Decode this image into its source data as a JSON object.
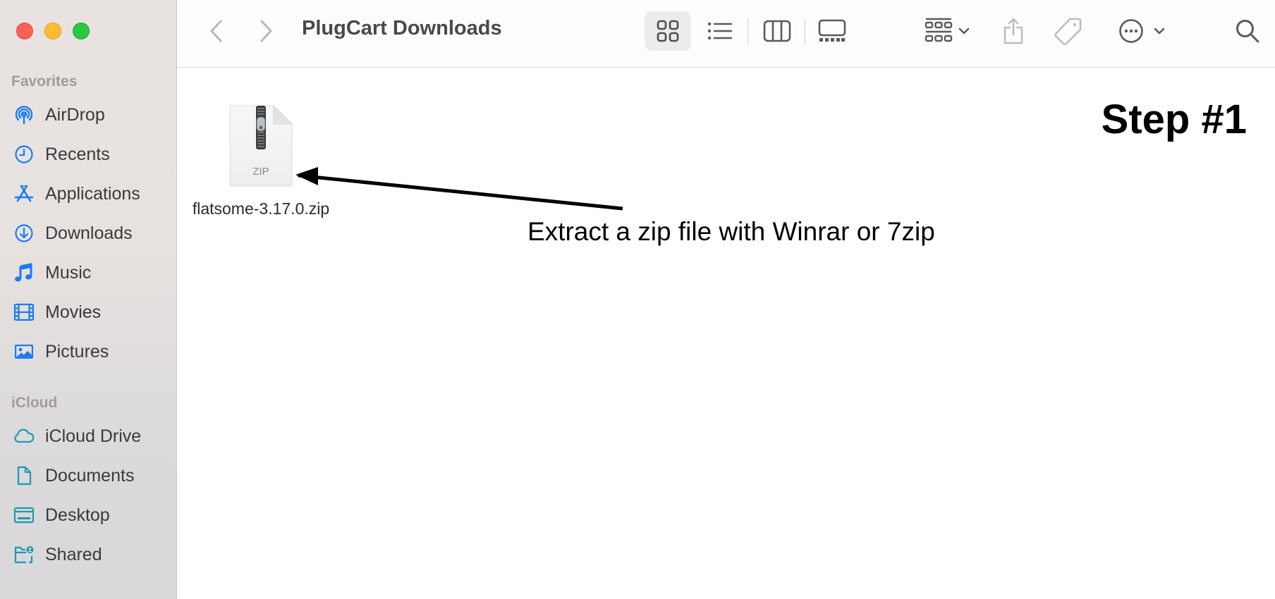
{
  "window": {
    "title": "PlugCart Downloads",
    "traffic_lights": {
      "close": "#fe5f57",
      "minimize": "#febc2e",
      "zoom": "#28c840"
    }
  },
  "sidebar": {
    "sections": [
      {
        "title": "Favorites",
        "items": [
          {
            "label": "AirDrop",
            "icon": "airdrop-icon",
            "color": "#1a7cf0"
          },
          {
            "label": "Recents",
            "icon": "clock-icon",
            "color": "#1a7cf0"
          },
          {
            "label": "Applications",
            "icon": "applications-icon",
            "color": "#1a7cf0"
          },
          {
            "label": "Downloads",
            "icon": "download-icon",
            "color": "#1a7cf0"
          },
          {
            "label": "Music",
            "icon": "music-note-icon",
            "color": "#1a7cf0"
          },
          {
            "label": "Movies",
            "icon": "film-icon",
            "color": "#1a7cf0"
          },
          {
            "label": "Pictures",
            "icon": "photo-icon",
            "color": "#1a7cf0"
          }
        ]
      },
      {
        "title": "iCloud",
        "items": [
          {
            "label": "iCloud Drive",
            "icon": "cloud-icon",
            "color": "#1b9ab5"
          },
          {
            "label": "Documents",
            "icon": "document-icon",
            "color": "#1b9ab5"
          },
          {
            "label": "Desktop",
            "icon": "desktop-icon",
            "color": "#1b9ab5"
          },
          {
            "label": "Shared",
            "icon": "shared-folder-icon",
            "color": "#1b9ab5"
          }
        ]
      }
    ]
  },
  "toolbar": {
    "back": "chevron-left-icon",
    "forward": "chevron-right-icon",
    "views": [
      "icon-view",
      "list-view",
      "column-view",
      "gallery-view"
    ],
    "active_view": "icon-view",
    "group_by": "group-by-icon",
    "share": "share-icon",
    "tags": "tag-icon",
    "more": "ellipsis-circle-icon",
    "search": "search-icon"
  },
  "content": {
    "files": [
      {
        "name": "flatsome-3.17.0.zip",
        "type_label": "ZIP"
      }
    ],
    "step_label": "Step #1",
    "annotation": "Extract a zip file with Winrar or 7zip"
  }
}
